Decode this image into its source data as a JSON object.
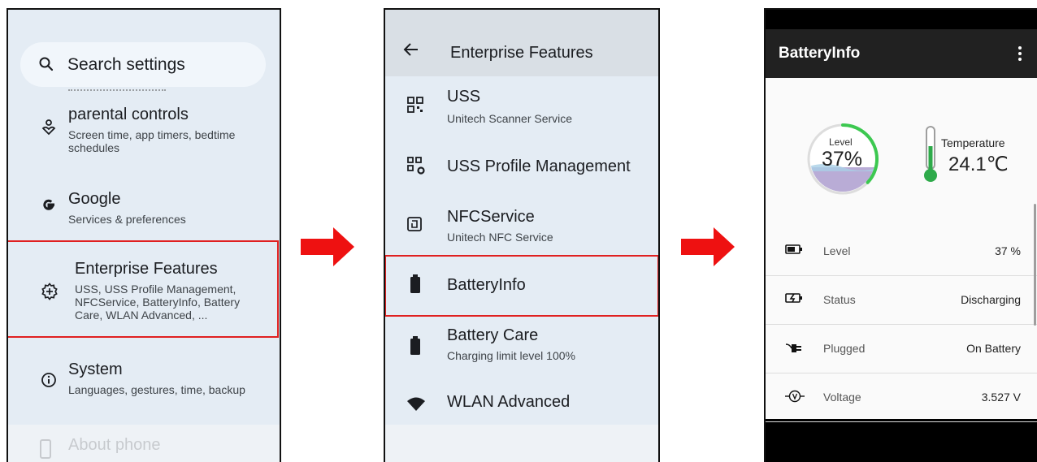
{
  "panel1": {
    "search_placeholder": "Search settings",
    "items": [
      {
        "title": "parental controls",
        "subtitle": "Screen time, app timers, bedtime schedules",
        "icon": "parental-controls-icon"
      },
      {
        "title": "Google",
        "subtitle": "Services & preferences",
        "icon": "google-icon"
      },
      {
        "title": "Enterprise Features",
        "subtitle": "USS, USS Profile Management, NFCService, BatteryInfo, Battery Care, WLAN Advanced, ...",
        "icon": "enterprise-icon"
      },
      {
        "title": "System",
        "subtitle": "Languages, gestures, time, backup",
        "icon": "info-icon"
      },
      {
        "title": "About phone",
        "icon": "phone-icon"
      }
    ]
  },
  "panel2": {
    "title": "Enterprise Features",
    "items": [
      {
        "title": "USS",
        "subtitle": "Unitech Scanner Service",
        "icon": "qr-code-icon"
      },
      {
        "title": "USS Profile Management",
        "icon": "qr-settings-icon"
      },
      {
        "title": "NFCService",
        "subtitle": "Unitech NFC Service",
        "icon": "nfc-icon"
      },
      {
        "title": "BatteryInfo",
        "icon": "battery-icon"
      },
      {
        "title": "Battery Care",
        "subtitle": "Charging limit level 100%",
        "icon": "battery-icon"
      },
      {
        "title": "WLAN Advanced",
        "icon": "wifi-icon"
      }
    ]
  },
  "panel3": {
    "title": "BatteryInfo",
    "gauge": {
      "label": "Level",
      "value": "37%",
      "fraction": 0.37
    },
    "temperature": {
      "label": "Temperature",
      "value": "24.1℃"
    },
    "rows": [
      {
        "label": "Level",
        "value": "37 %",
        "icon": "battery-level-icon"
      },
      {
        "label": "Status",
        "value": "Discharging",
        "icon": "charging-status-icon"
      },
      {
        "label": "Plugged",
        "value": "On Battery",
        "icon": "plug-icon"
      },
      {
        "label": "Voltage",
        "value": "3.527 V",
        "icon": "voltage-icon"
      }
    ]
  },
  "colors": {
    "highlight": "#e02020",
    "arrow": "#ee1111",
    "gauge_green": "#3cc850",
    "thermo_green": "#2eaa4a"
  }
}
